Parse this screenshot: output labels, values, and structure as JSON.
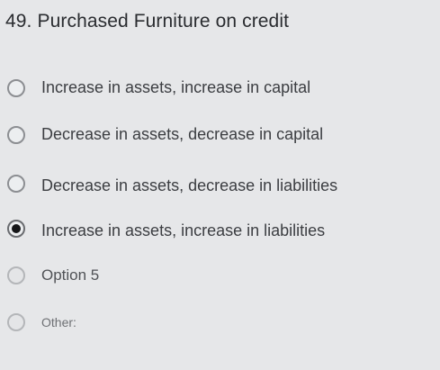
{
  "question": {
    "number": "49.",
    "text": "Purchased Furniture on credit"
  },
  "options": [
    {
      "label": "Increase in assets, increase in capital",
      "selected": false
    },
    {
      "label": "Decrease in assets, decrease in capital",
      "selected": false
    },
    {
      "label": "Decrease in assets, decrease in liabilities",
      "selected": false
    },
    {
      "label": "Increase in assets, increase in liabilities",
      "selected": true
    },
    {
      "label": "Option 5",
      "selected": false
    },
    {
      "label": "Other:",
      "selected": false
    }
  ]
}
